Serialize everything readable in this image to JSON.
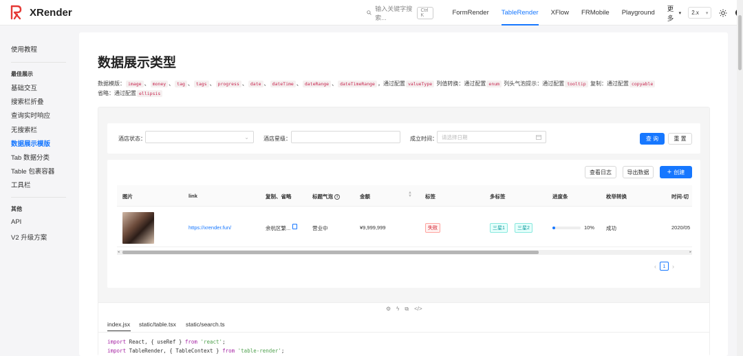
{
  "app": {
    "name": "XRender"
  },
  "topnav": {
    "search_placeholder": "输入关键字搜索...",
    "shortcut": "Ctrl K",
    "links": [
      "FormRender",
      "TableRender",
      "XFlow",
      "FRMobile",
      "Playground",
      "更多"
    ],
    "active_link": "TableRender",
    "version": "2.x"
  },
  "sidebar": {
    "top_item": "使用教程",
    "group1_title": "最佳展示",
    "group1_items": [
      "基础交互",
      "搜索栏折叠",
      "查询实时响应",
      "无搜索栏",
      "数据展示模版",
      "Tab 数据分类",
      "Table 包裹容器",
      "工具栏"
    ],
    "active_item": "数据展示模版",
    "group2_title": "其他",
    "group2_items": [
      "API",
      "V2 升级方案"
    ]
  },
  "page": {
    "title": "数据展示类型",
    "desc_prefix": "数据模版：",
    "desc_types": [
      "image",
      "money",
      "tag",
      "tags",
      "progress",
      "date",
      "dateTime",
      "dateRange",
      "dateTimeRange"
    ],
    "desc_valuetype_text": "，通过配置",
    "desc_valuetype_code": "valueType",
    "desc_enum_text": " 列值转换：通过配置",
    "desc_enum_code": "enum",
    "desc_tooltip_text": " 列头气泡提示：通过配置",
    "desc_tooltip_code": "tooltip",
    "desc_copy_text": " 复制：通过配置",
    "desc_copy_code": "copyable",
    "desc_ellipsis_text": "省略：通过配置",
    "desc_ellipsis_code": "ellipsis"
  },
  "search_form": {
    "status_label": "酒店状态：",
    "star_label": "酒店星级：",
    "time_label": "成立时间：",
    "date_placeholder": "请选择日期",
    "search_btn": "查 询",
    "reset_btn": "重 置"
  },
  "toolbar": {
    "log_btn": "查看日志",
    "export_btn": "导出数据",
    "create_btn": "创建"
  },
  "table": {
    "columns": [
      "图片",
      "link",
      "复制、省略",
      "标题气泡",
      "金额",
      "标签",
      "多标签",
      "进度条",
      "枚举转换",
      "时间-切"
    ],
    "row": {
      "link": "https://xrender.fun/",
      "copy": "余杭区繁...",
      "status": "营业中",
      "money": "¥9,999,999",
      "tag": "失败",
      "tags": [
        "三星1",
        "三星2"
      ],
      "progress": 0.1,
      "progress_label": "10%",
      "enum": "成功",
      "time": "2020/05"
    }
  },
  "pagination": {
    "current": "1"
  },
  "code": {
    "tabs": [
      "index.jsx",
      "static/table.tsx",
      "static/search.ts"
    ],
    "active_tab": "index.jsx",
    "line1": {
      "kw1": "import",
      "body": " React, { useRef } ",
      "kw2": "from",
      "str": " 'react'",
      "end": ";"
    },
    "line2": {
      "kw1": "import",
      "body": " TableRender, { TableContext } ",
      "kw2": "from",
      "str": " 'table-render'",
      "end": ";"
    }
  },
  "colors": {
    "accent": "#1677ff",
    "logo": "#e53935"
  }
}
